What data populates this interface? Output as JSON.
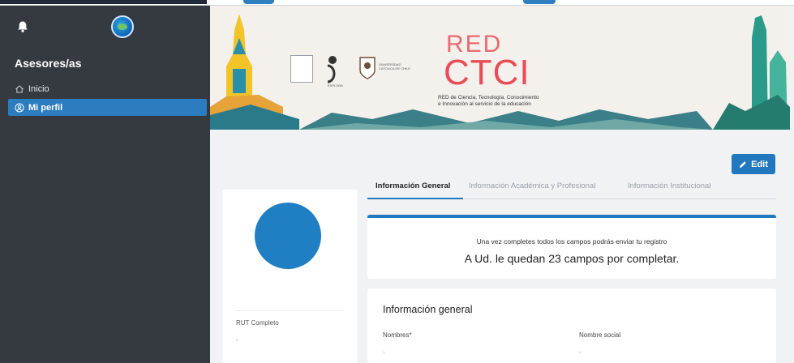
{
  "sidebar": {
    "role_title": "Asesores/as",
    "items": [
      {
        "label": "Inicio",
        "icon": "home-icon",
        "active": false
      },
      {
        "label": "Mi perfil",
        "icon": "user-circle-icon",
        "active": true
      }
    ]
  },
  "banner": {
    "red_label": "RED",
    "ctci_label": "CTCI",
    "subtitle_line1": "RED de Ciencia, Tecnología, Conocimiento",
    "subtitle_line2": "e Innovación al servicio de la educación",
    "logo_explora": "EXPLORA",
    "logo_universidad": "UNIVERSIDAD CATOLICA DE CHILE"
  },
  "actions": {
    "edit_label": "Edit"
  },
  "tabs": [
    {
      "label": "Información General",
      "active": true
    },
    {
      "label": "Información Académica y Profesional",
      "active": false
    },
    {
      "label": "Información Institucional",
      "active": false
    }
  ],
  "profile": {
    "rut_label": "RUT Completo",
    "rut_value": "-"
  },
  "notice": {
    "line1": "Una vez completes todos los campos podrás enviar tu registro",
    "line2": "A Ud. le quedan 23 campos por completar."
  },
  "general_info": {
    "title": "Información general",
    "fields": [
      {
        "label": "Nombres*",
        "value": "-"
      },
      {
        "label": "Nombre social",
        "value": "-"
      }
    ]
  },
  "colors": {
    "sidebar_bg": "#343a40",
    "accent": "#2178be",
    "ctci_red": "#e84d57"
  }
}
